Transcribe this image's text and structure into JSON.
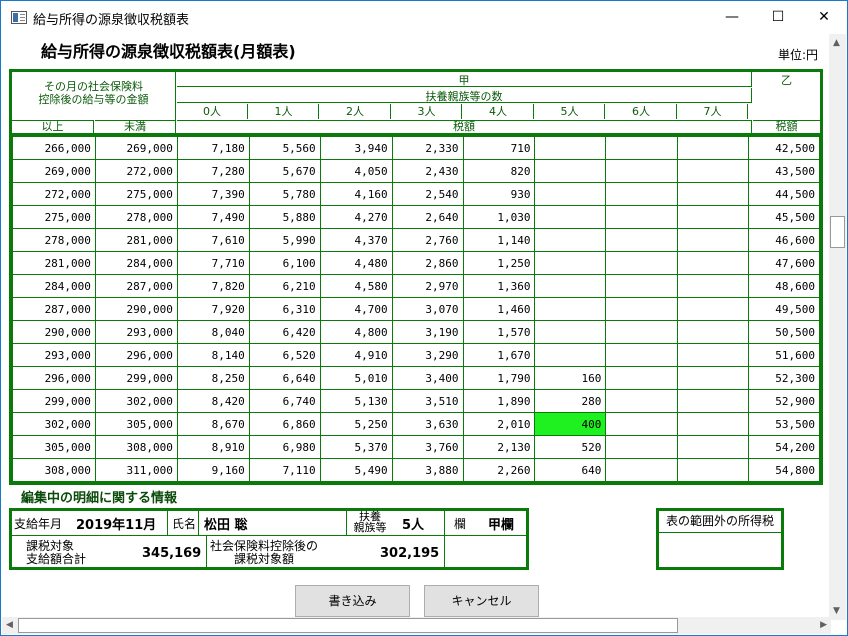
{
  "window": {
    "title": "給与所得の源泉徴収税額表",
    "minimize": "—",
    "maximize": "☐",
    "close": "✕"
  },
  "page": {
    "title": "給与所得の源泉徴収税額表(月額表)",
    "unit": "単位:円"
  },
  "header": {
    "label_line1": "その月の社会保険料",
    "label_line2": "控除後の給与等の金額",
    "ko": "甲",
    "otsu": "乙",
    "dependents": "扶養親族等の数",
    "persons": [
      "0人",
      "1人",
      "2人",
      "3人",
      "4人",
      "5人",
      "6人",
      "7人"
    ],
    "from": "以上",
    "to": "未満",
    "tax": "税額",
    "tax_otsu": "税額"
  },
  "rows": [
    [
      "266,000",
      "269,000",
      "7,180",
      "5,560",
      "3,940",
      "2,330",
      "710",
      "",
      "",
      "",
      "42,500"
    ],
    [
      "269,000",
      "272,000",
      "7,280",
      "5,670",
      "4,050",
      "2,430",
      "820",
      "",
      "",
      "",
      "43,500"
    ],
    [
      "272,000",
      "275,000",
      "7,390",
      "5,780",
      "4,160",
      "2,540",
      "930",
      "",
      "",
      "",
      "44,500"
    ],
    [
      "275,000",
      "278,000",
      "7,490",
      "5,880",
      "4,270",
      "2,640",
      "1,030",
      "",
      "",
      "",
      "45,500"
    ],
    [
      "278,000",
      "281,000",
      "7,610",
      "5,990",
      "4,370",
      "2,760",
      "1,140",
      "",
      "",
      "",
      "46,600"
    ],
    [
      "281,000",
      "284,000",
      "7,710",
      "6,100",
      "4,480",
      "2,860",
      "1,250",
      "",
      "",
      "",
      "47,600"
    ],
    [
      "284,000",
      "287,000",
      "7,820",
      "6,210",
      "4,580",
      "2,970",
      "1,360",
      "",
      "",
      "",
      "48,600"
    ],
    [
      "287,000",
      "290,000",
      "7,920",
      "6,310",
      "4,700",
      "3,070",
      "1,460",
      "",
      "",
      "",
      "49,500"
    ],
    [
      "290,000",
      "293,000",
      "8,040",
      "6,420",
      "4,800",
      "3,190",
      "1,570",
      "",
      "",
      "",
      "50,500"
    ],
    [
      "293,000",
      "296,000",
      "8,140",
      "6,520",
      "4,910",
      "3,290",
      "1,670",
      "",
      "",
      "",
      "51,600"
    ],
    [
      "296,000",
      "299,000",
      "8,250",
      "6,640",
      "5,010",
      "3,400",
      "1,790",
      "160",
      "",
      "",
      "52,300"
    ],
    [
      "299,000",
      "302,000",
      "8,420",
      "6,740",
      "5,130",
      "3,510",
      "1,890",
      "280",
      "",
      "",
      "52,900"
    ],
    [
      "302,000",
      "305,000",
      "8,670",
      "6,860",
      "5,250",
      "3,630",
      "2,010",
      "400",
      "",
      "",
      "53,500"
    ],
    [
      "305,000",
      "308,000",
      "8,910",
      "6,980",
      "5,370",
      "3,760",
      "2,130",
      "520",
      "",
      "",
      "54,200"
    ],
    [
      "308,000",
      "311,000",
      "9,160",
      "7,110",
      "5,490",
      "3,880",
      "2,260",
      "640",
      "",
      "",
      "54,800"
    ]
  ],
  "highlight": {
    "row": 12,
    "col": 7
  },
  "info": {
    "heading": "編集中の明細に関する情報",
    "pay_month_label": "支給年月",
    "pay_month_value": "2019年11月",
    "name_label": "氏名",
    "name_value": "松田 聡",
    "dependents_label1": "扶養",
    "dependents_label2": "親族等",
    "dependents_value": "5人",
    "column_label": "欄",
    "column_value": "甲欄",
    "taxable_label1": "課税対象",
    "taxable_label2": "支給額合計",
    "taxable_value": "345,169",
    "after_ins_label1": "社会保険料控除後の",
    "after_ins_label2": "課税対象額",
    "after_ins_value": "302,195",
    "out_of_range_label": "表の範囲外の所得税"
  },
  "buttons": {
    "write": "書き込み",
    "cancel": "キャンセル"
  },
  "colors": {
    "grid_green": "#0a7a0a",
    "highlight": "#1ff01f"
  }
}
